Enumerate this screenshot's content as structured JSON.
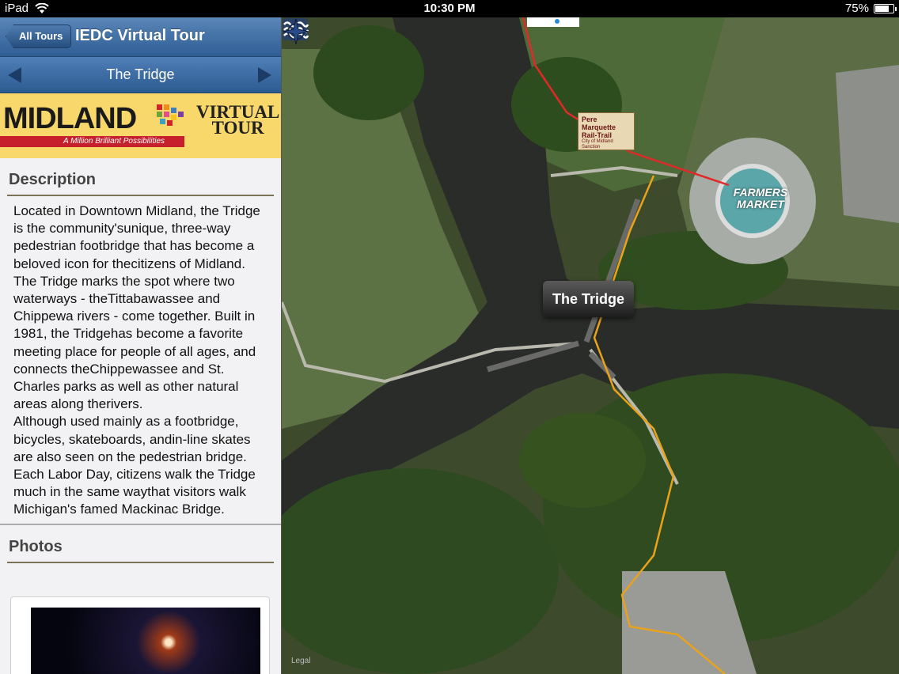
{
  "status": {
    "device": "iPad",
    "time": "10:30 PM",
    "battery": "75%",
    "battery_level": 0.75
  },
  "nav": {
    "back_label": "All Tours",
    "title": "IEDC Virtual Tour"
  },
  "stop": {
    "title": "The Tridge"
  },
  "banner": {
    "brand": "MIDLAND",
    "sub1": "VIRTUAL",
    "sub2": "TOUR",
    "tagline": "A Million Brilliant Possibilities"
  },
  "description": {
    "heading": "Description",
    "para1": "Located in Downtown Midland, the Tridge is the community'sunique, three-way pedestrian footbridge that has become a beloved icon for thecitizens of Midland. The Tridge marks the spot where two waterways - theTittabawassee and Chippewa rivers - come together. Built in 1981, the Tridgehas become a favorite meeting place for people of all ages, and connects theChippewassee and St. Charles parks as well as other natural areas along therivers.",
    "para2": "Although used mainly as a footbridge, bicycles, skateboards, andin-line skates are also seen on the pedestrian bridge. Each Labor Day, citizens walk the Tridge much in the same waythat visitors walk Michigan's famed Mackinac Bridge."
  },
  "photos": {
    "heading": "Photos"
  },
  "map": {
    "callout": "The Tridge",
    "sign_line1": "Pere",
    "sign_line2": "Marquette",
    "sign_line3": "Rail-Trail",
    "sign_line4": "City of Midland Sanction",
    "market_line1": "FARMERS",
    "market_line2": "MARKET",
    "legal": "Legal",
    "trail_color": "#e8a21c",
    "rail_color": "#e02a2a"
  }
}
